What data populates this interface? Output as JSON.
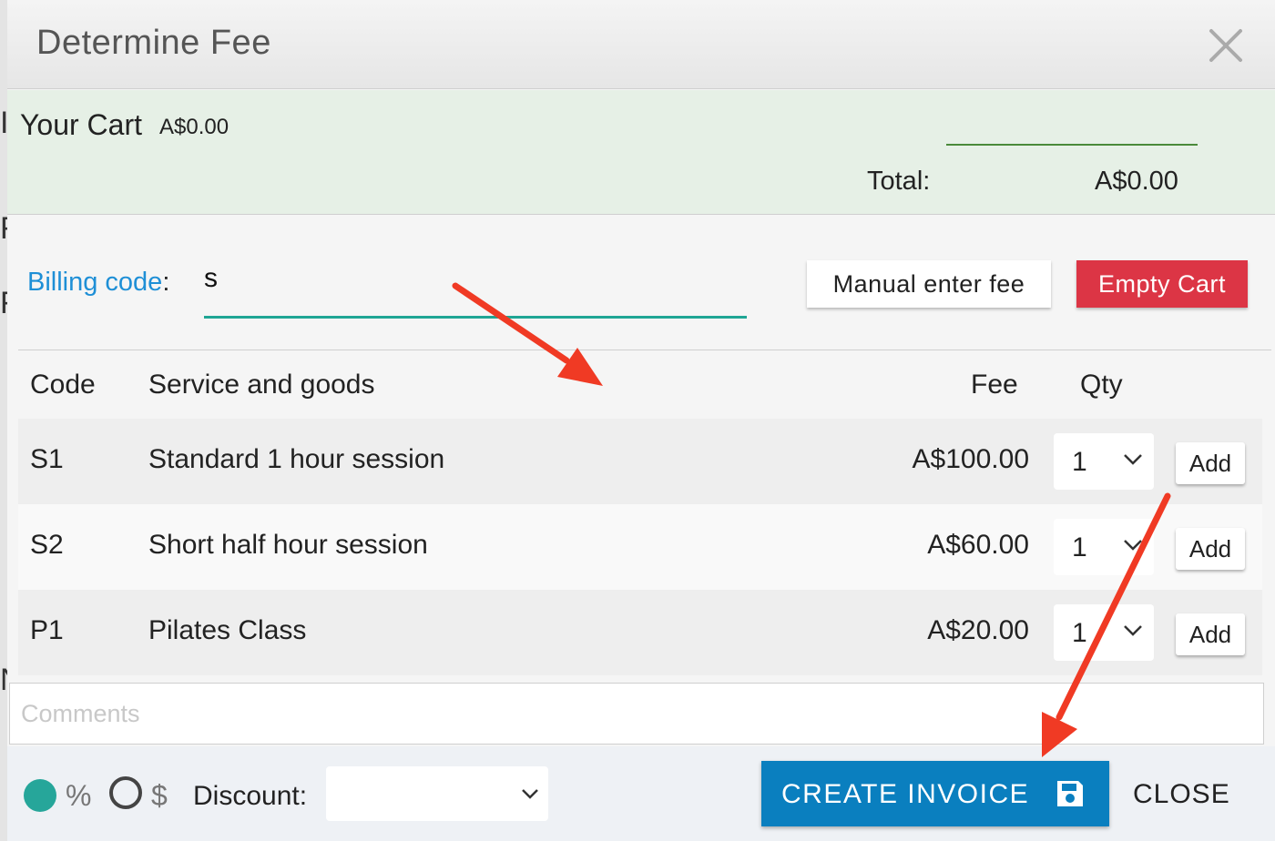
{
  "background": {
    "glyphs": [
      "I",
      "F",
      "F",
      "N"
    ]
  },
  "modal": {
    "title": "Determine Fee",
    "close_icon": "close-icon"
  },
  "cart": {
    "title": "Your Cart",
    "amount": "A$0.00",
    "total_label": "Total:",
    "total_value": "A$0.00"
  },
  "billing": {
    "label": "Billing code",
    "colon": ":",
    "value": "s"
  },
  "buttons": {
    "manual": "Manual enter fee",
    "empty_cart": "Empty Cart",
    "create_invoice": "CREATE INVOICE",
    "close": "CLOSE"
  },
  "table": {
    "headers": {
      "code": "Code",
      "service": "Service and goods",
      "fee": "Fee",
      "qty": "Qty"
    },
    "rows": [
      {
        "code": "S1",
        "service": "Standard 1 hour session",
        "fee": "A$100.00",
        "qty": "1",
        "add": "Add"
      },
      {
        "code": "S2",
        "service": "Short half hour session",
        "fee": "A$60.00",
        "qty": "1",
        "add": "Add"
      },
      {
        "code": "P1",
        "service": "Pilates Class",
        "fee": "A$20.00",
        "qty": "1",
        "add": "Add"
      }
    ]
  },
  "comments": {
    "placeholder": "Comments"
  },
  "footer": {
    "percent_symbol": "%",
    "dollar_symbol": "$",
    "percent_selected": true,
    "discount_label": "Discount:",
    "discount_value": ""
  },
  "colors": {
    "accent_teal": "#26a69a",
    "link_blue": "#1e8fd6",
    "danger_red": "#dc3545",
    "primary_blue": "#0a7fbf",
    "cart_green_bg": "#e6f0e6",
    "annotation_red": "#f03a24"
  }
}
